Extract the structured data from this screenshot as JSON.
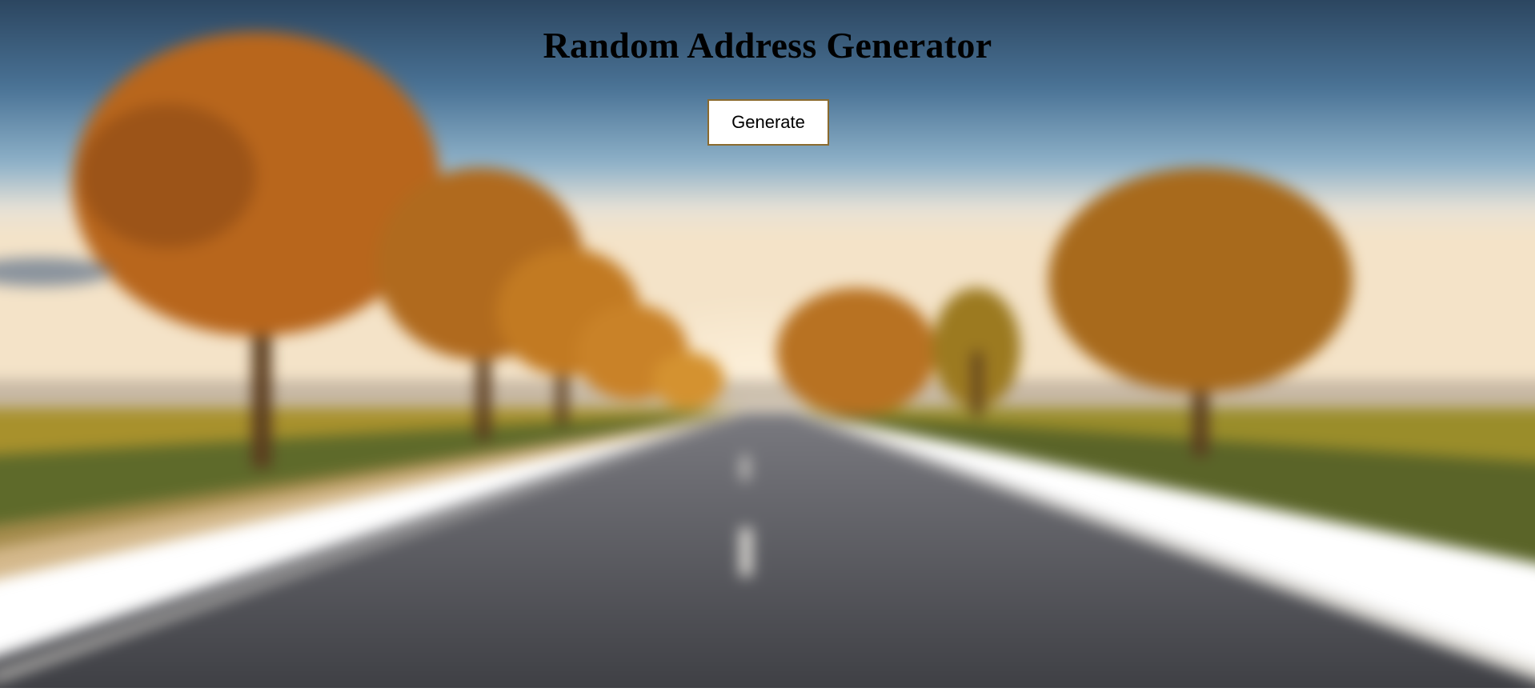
{
  "page": {
    "title": "Random Address Generator"
  },
  "controls": {
    "generate_label": "Generate"
  },
  "background": {
    "description_icon": "road-landscape-photo",
    "sky_top": "#2a3f55",
    "sky_horizon": "#f3e6d0",
    "tree_color": "#b8651c",
    "road_color": "#4a4b50"
  }
}
